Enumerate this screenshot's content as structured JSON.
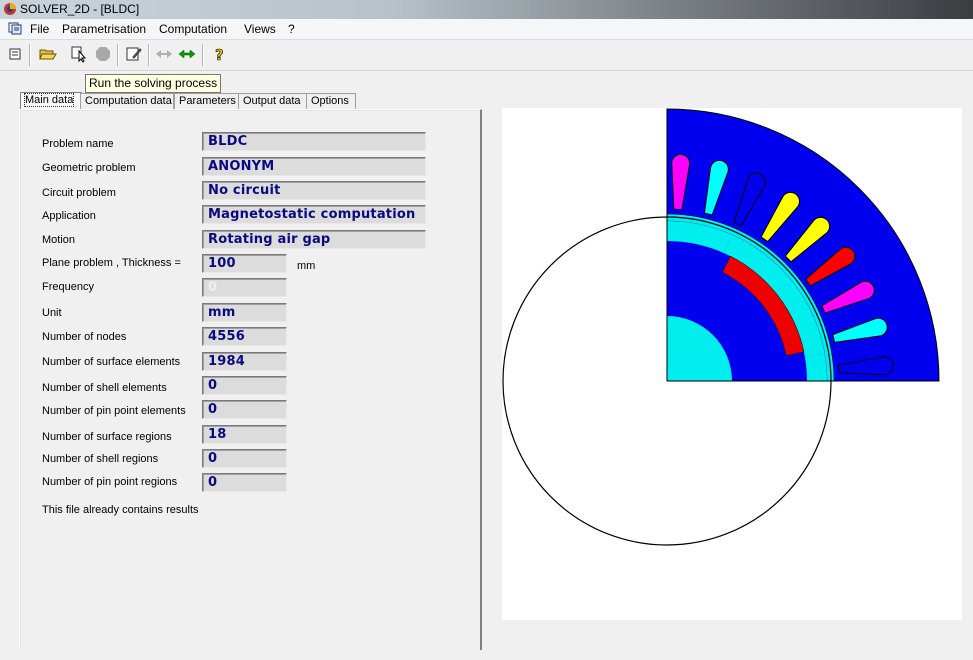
{
  "window": {
    "title": "SOLVER_2D - [BLDC]"
  },
  "menu": {
    "items": [
      "File",
      "Parametrisation",
      "Computation",
      "Views",
      "?"
    ]
  },
  "toolbar": {
    "tooltip": "Run the solving process"
  },
  "tabs": [
    "Main data",
    "Computation data",
    "Parameters",
    "Output data",
    "Options"
  ],
  "main": {
    "problem_name_label": "Problem name",
    "problem_name": "BLDC",
    "geometric_problem_label": "Geometric problem",
    "geometric_problem": "ANONYM",
    "circuit_problem_label": "Circuit problem",
    "circuit_problem": "No circuit",
    "application_label": "Application",
    "application": "Magnetostatic computation",
    "motion_label": "Motion",
    "motion": "Rotating air gap",
    "thickness_label": "Plane problem  , Thickness =",
    "thickness": "100",
    "thickness_unit": "mm",
    "frequency_label": "Frequency",
    "frequency": "0",
    "unit_label": "Unit",
    "unit": "mm",
    "nodes_label": "Number of nodes",
    "nodes": "4556",
    "surface_elements_label": "Number of surface elements",
    "surface_elements": "1984",
    "shell_elements_label": "Number of shell elements",
    "shell_elements": "0",
    "pin_point_elements_label": "Number of pin point elements",
    "pin_point_elements": "0",
    "surface_regions_label": "Number of surface regions",
    "surface_regions": "18",
    "shell_regions_label": "Number of shell regions",
    "shell_regions": "0",
    "pin_point_regions_label": "Number of pin point regions",
    "pin_point_regions": "0",
    "results_info": "This file already contains results"
  },
  "colors": {
    "stator": "#0000ee",
    "magnet": "#ee0000",
    "rotor_core": "#0000ee",
    "shaft": "#00eeee",
    "gap": "#00eeee",
    "winding_magenta": "#ff00ff",
    "winding_yellow": "#ffff00",
    "winding_red": "#ff0000",
    "winding_cyan": "#00ffff"
  }
}
